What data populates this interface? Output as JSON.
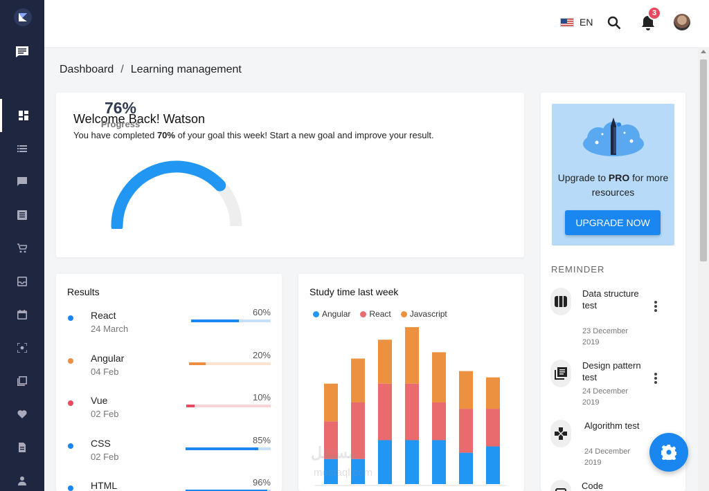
{
  "topbar": {
    "language": "EN",
    "notification_count": "3"
  },
  "breadcrumb": {
    "root": "Dashboard",
    "separator": "/",
    "current": "Learning management"
  },
  "welcome": {
    "title": "Welcome Back! Watson",
    "subtitle_before": "You have completed ",
    "subtitle_bold": "70%",
    "subtitle_after": " of your goal this week! Start a new goal and improve your result.",
    "gauge_value": "76%",
    "gauge_label": "Progress",
    "gauge_fraction": 0.76
  },
  "promo": {
    "text_before": "Upgrade to ",
    "text_bold": "PRO",
    "text_after": " for more resources",
    "button": "UPGRADE NOW"
  },
  "reminder": {
    "heading": "REMINDER",
    "items": [
      {
        "title": "Data structure test",
        "date": "23 December 2019",
        "icon": "columns-icon"
      },
      {
        "title": "Design pattern test",
        "date": "24 December 2019",
        "icon": "library-icon"
      },
      {
        "title": "Algorithm test",
        "date": "24 December 2019",
        "icon": "gamepad-icon"
      },
      {
        "title": "Code",
        "date": "",
        "icon": "code-icon"
      }
    ]
  },
  "results": {
    "title": "Results",
    "items": [
      {
        "name": "React",
        "date": "24 March",
        "percent": "60%",
        "value": 0.6,
        "color": "#1a86f0"
      },
      {
        "name": "Angular",
        "date": "04 Feb",
        "percent": "20%",
        "value": 0.2,
        "color": "#ec8f45"
      },
      {
        "name": "Vue",
        "date": "02 Feb",
        "percent": "10%",
        "value": 0.1,
        "color": "#e84a5f"
      },
      {
        "name": "CSS",
        "date": "02 Feb",
        "percent": "85%",
        "value": 0.85,
        "color": "#1a86f0"
      },
      {
        "name": "HTML",
        "date": "",
        "percent": "96%",
        "value": 0.96,
        "color": "#1a86f0"
      }
    ]
  },
  "chart_data": {
    "type": "bar",
    "stacked": true,
    "title": "Study time last week",
    "categories": [
      "",
      "",
      "",
      "",
      "",
      "",
      ""
    ],
    "series": [
      {
        "name": "Angular",
        "color": "#2196f3",
        "values": [
          4,
          4,
          7,
          7,
          7,
          5,
          6
        ]
      },
      {
        "name": "React",
        "color": "#e96b6e",
        "values": [
          6,
          9,
          9,
          9,
          6,
          7,
          6
        ]
      },
      {
        "name": "Javascript",
        "color": "#ec9140",
        "values": [
          6,
          7,
          7,
          9,
          8,
          6,
          5
        ]
      }
    ],
    "ylim": [
      0,
      26
    ],
    "legend": "top-left"
  },
  "watermark": {
    "arabic": "مستقل",
    "latin": "mostaql.com"
  }
}
